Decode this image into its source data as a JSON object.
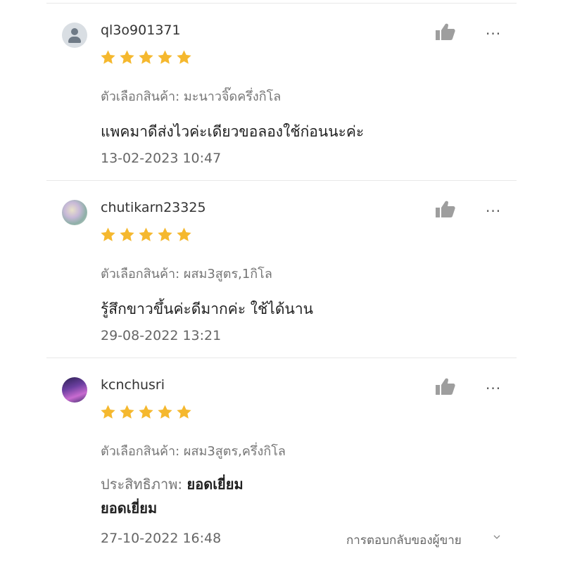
{
  "reviews": [
    {
      "username": "ql3o901371",
      "avatar": "default-user-icon",
      "rating": 5,
      "variant": "ตัวเลือกสินค้า: มะนาวจิ๊ดครึ่งกิโล",
      "comment": "แพคมาดีส่งไวค่ะเดียวขอลองใช้ก่อนนะค่ะ",
      "date": "13-02-2023 10:47"
    },
    {
      "username": "chutikarn23325",
      "avatar": "user-photo",
      "rating": 5,
      "variant": "ตัวเลือกสินค้า: ผสม3สูตร,1กิโล",
      "comment": "รู้สึกขาวขึ้นค่ะดีมากค่ะ ใช้ได้นาน",
      "date": "29-08-2022 13:21"
    },
    {
      "username": "kcnchusri",
      "avatar": "user-photo",
      "rating": 5,
      "variant": "ตัวเลือกสินค้า: ผสม3สูตร,ครึ่งกิโล",
      "attribute_label": "ประสิทธิภาพ:",
      "attribute_value": "ยอดเยี่ยม",
      "comment": "ยอดเยี่ยม",
      "date": "27-10-2022 16:48",
      "seller_reply": "การตอบกลับของผู้ขาย"
    }
  ],
  "icons": {
    "like": "thumbs-up-icon",
    "more": "more-options-icon",
    "star": "star-icon",
    "expand": "chevron-down-icon"
  },
  "more_glyph": "···",
  "colors": {
    "star": "#F5B82E",
    "like": "#9e9e9e",
    "divider": "#e8e8e8"
  }
}
